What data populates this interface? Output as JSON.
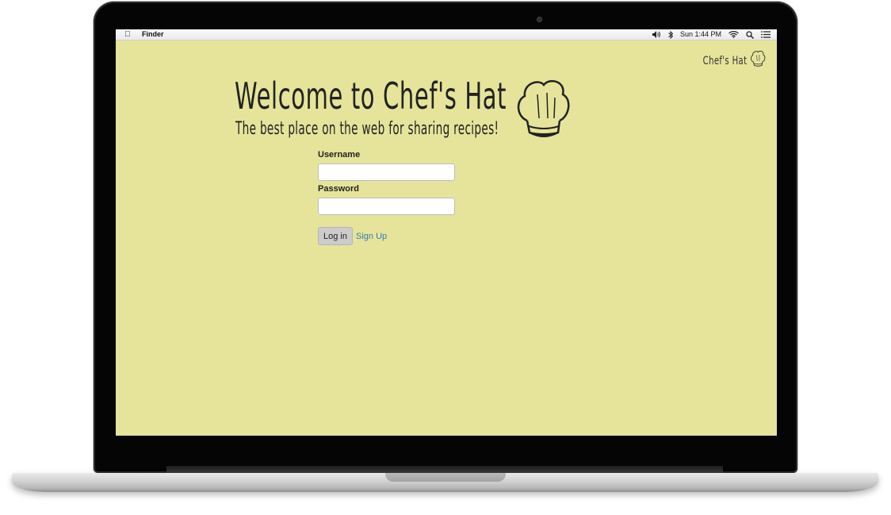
{
  "menubar": {
    "apple_icon": "apple-logo",
    "app_name": "Finder",
    "clock": "Sun 1:44 PM",
    "status_icons": [
      "volume-icon",
      "bluetooth-icon",
      "wifi-icon",
      "spotlight-search-icon",
      "notification-center-icon"
    ]
  },
  "brand": {
    "name": "Chef's Hat",
    "icon": "chef-hat-icon"
  },
  "hero": {
    "title": "Welcome to Chef's Hat",
    "subtitle": "The best place on the web for sharing recipes!",
    "icon": "chef-hat-icon"
  },
  "login_form": {
    "username_label": "Username",
    "username_value": "",
    "password_label": "Password",
    "password_value": "",
    "login_button": "Log in",
    "signup_link": "Sign Up"
  },
  "colors": {
    "page_background": "#e6e49b",
    "link": "#337ab7",
    "button_background": "#cccccc"
  }
}
